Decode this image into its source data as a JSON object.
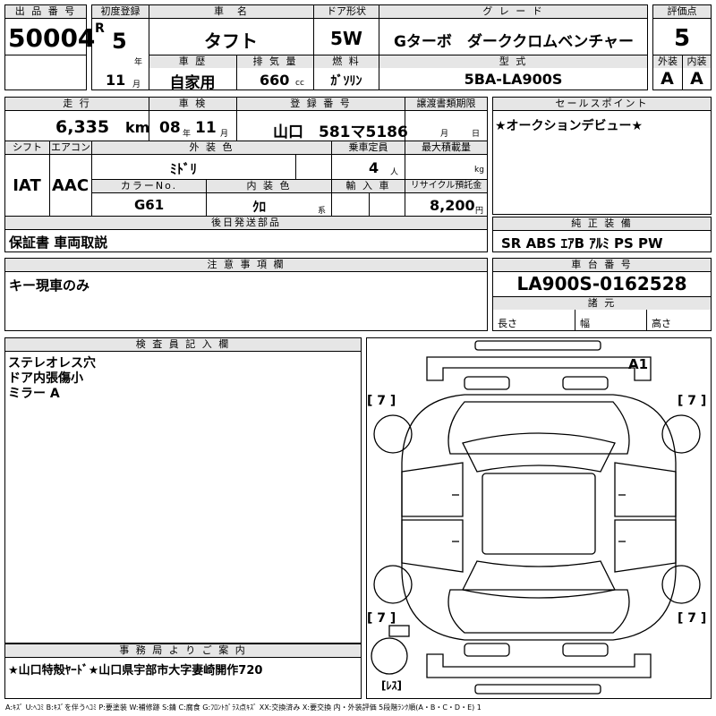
{
  "header_labels": {
    "lot": "出 品 番 号",
    "first_reg": "初度登録",
    "car_name": "車　名",
    "door": "ドア形状",
    "grade": "グ レ ー ド",
    "score": "評価点",
    "history": "車 歴",
    "displacement": "排 気 量",
    "fuel": "燃 料",
    "model_code": "型 式",
    "exterior": "外装",
    "interior": "内装",
    "mileage": "走 行",
    "inspection": "車 検",
    "reg_no": "登 録 番 号",
    "transfer": "譲渡書類期限",
    "sales_point": "セールスポイント",
    "shift": "シフト",
    "ac": "エアコン",
    "ext_color": "外 装 色",
    "capacity": "乗車定員",
    "max_load": "最大積載量",
    "color_no": "カラーNo.",
    "int_color": "内 装 色",
    "import": "輸 入 車",
    "recycle": "リサイクル預託金",
    "deferred": "後日発送部品",
    "standard_equip": "純 正 装 備",
    "notes": "注 意 事 項 欄",
    "chassis": "車 台 番 号",
    "specs": "諸 元",
    "inspector": "検 査 員 記 入 欄",
    "office": "事 務 局 よ り ご 案 内"
  },
  "lot_number": "50004",
  "first_reg": {
    "era": "R",
    "year": "5",
    "year_unit": "年",
    "month": "11",
    "month_unit": "月"
  },
  "car_name": "タフト",
  "door": "5W",
  "grade": "Gターボ　ダーククロムベンチャー",
  "score": "5",
  "history": "自家用",
  "displacement": "660",
  "displacement_unit": "cc",
  "fuel": "ｶﾞｿﾘﾝ",
  "model_code": "5BA-LA900S",
  "exterior_grade": "A",
  "interior_grade": "A",
  "mileage": "6,335",
  "mileage_unit": "km",
  "inspection": {
    "year": "08",
    "year_unit": "年",
    "month": "11",
    "month_unit": "月"
  },
  "reg_no": "山口　581マ5186",
  "transfer_month_unit": "月",
  "transfer_day_unit": "日",
  "sales_point": "★オークションデビュー★",
  "shift": "IAT",
  "ac": "AAC",
  "ext_color": "ﾐﾄﾞﾘ",
  "capacity": "4",
  "capacity_unit": "人",
  "max_load_unit": "kg",
  "color_no": "G61",
  "int_color": "ｸﾛ",
  "int_color_unit": "系",
  "recycle": "8,200",
  "recycle_unit": "円",
  "deferred": "保証書 車両取説",
  "standard_equip": "SR ABS ｴｱB ｱﾙﾐ PS PW",
  "notes": "キー現車のみ",
  "chassis_no": "LA900S-0162528",
  "spec_labels": {
    "length": "長さ",
    "width": "幅",
    "height": "高さ"
  },
  "inspector_notes": [
    "ステレオレス穴",
    "ドア内張傷小",
    "ミラー A"
  ],
  "office_note": "★山口特殻ﾔｰﾄﾞ★山口県宇部市大字妻崎開作720",
  "diagram": {
    "marks": [
      "[ 7 ]",
      "[ 7 ]",
      "[ 7 ]",
      "[ 7 ]"
    ],
    "a1": "A1",
    "spare": "[ﾚｽ]"
  },
  "legend": "A:ｷｽﾞ U:ﾍｺﾐ B:ｷｽﾞを伴うﾍｺﾐ P:要塗装 W:補修跡 S:錆 C:腐食 G:ﾌﾛﾝﾄｶﾞﾗｽ点ｷｽﾞ XX:交換済み X:要交換 内・外装評価 5段階ﾗﾝｸ順(A・B・C・D・E) 1"
}
